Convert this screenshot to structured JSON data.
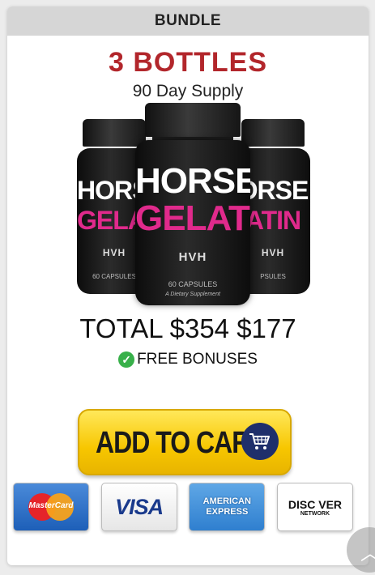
{
  "header": {
    "label": "BUNDLE"
  },
  "offer": {
    "title": "3 BOTTLES",
    "subtitle": "90 Day Supply",
    "total_label": "TOTAL",
    "original_price": "$354",
    "sale_price": "$177",
    "bonus_text": "FREE BONUSES"
  },
  "product": {
    "word1": "HORSE",
    "word2": "GELATIN",
    "logo": "HVH",
    "capsules": "60 CAPSULES",
    "tagline": "A Dietary Supplement",
    "left_word1": "HORSE",
    "left_word2": "GELATI",
    "left_capsules": "60 CAPSULES",
    "right_word1": "ORSE",
    "right_word2": "ATIN",
    "right_capsules": "PSULES"
  },
  "cart_button": {
    "label": "ADD TO CART",
    "icon": "shopping-cart-icon"
  },
  "payments": {
    "mastercard": "MasterCard",
    "visa": "VISA",
    "amex_line1": "AMERICAN",
    "amex_line2": "EXPRESS",
    "discover": "DISC VER",
    "discover_network": "NETWORK"
  },
  "colors": {
    "title_red": "#b2262b",
    "accent_pink": "#e02a8c",
    "cart_yellow": "#f7c600",
    "check_green": "#38b04a"
  }
}
